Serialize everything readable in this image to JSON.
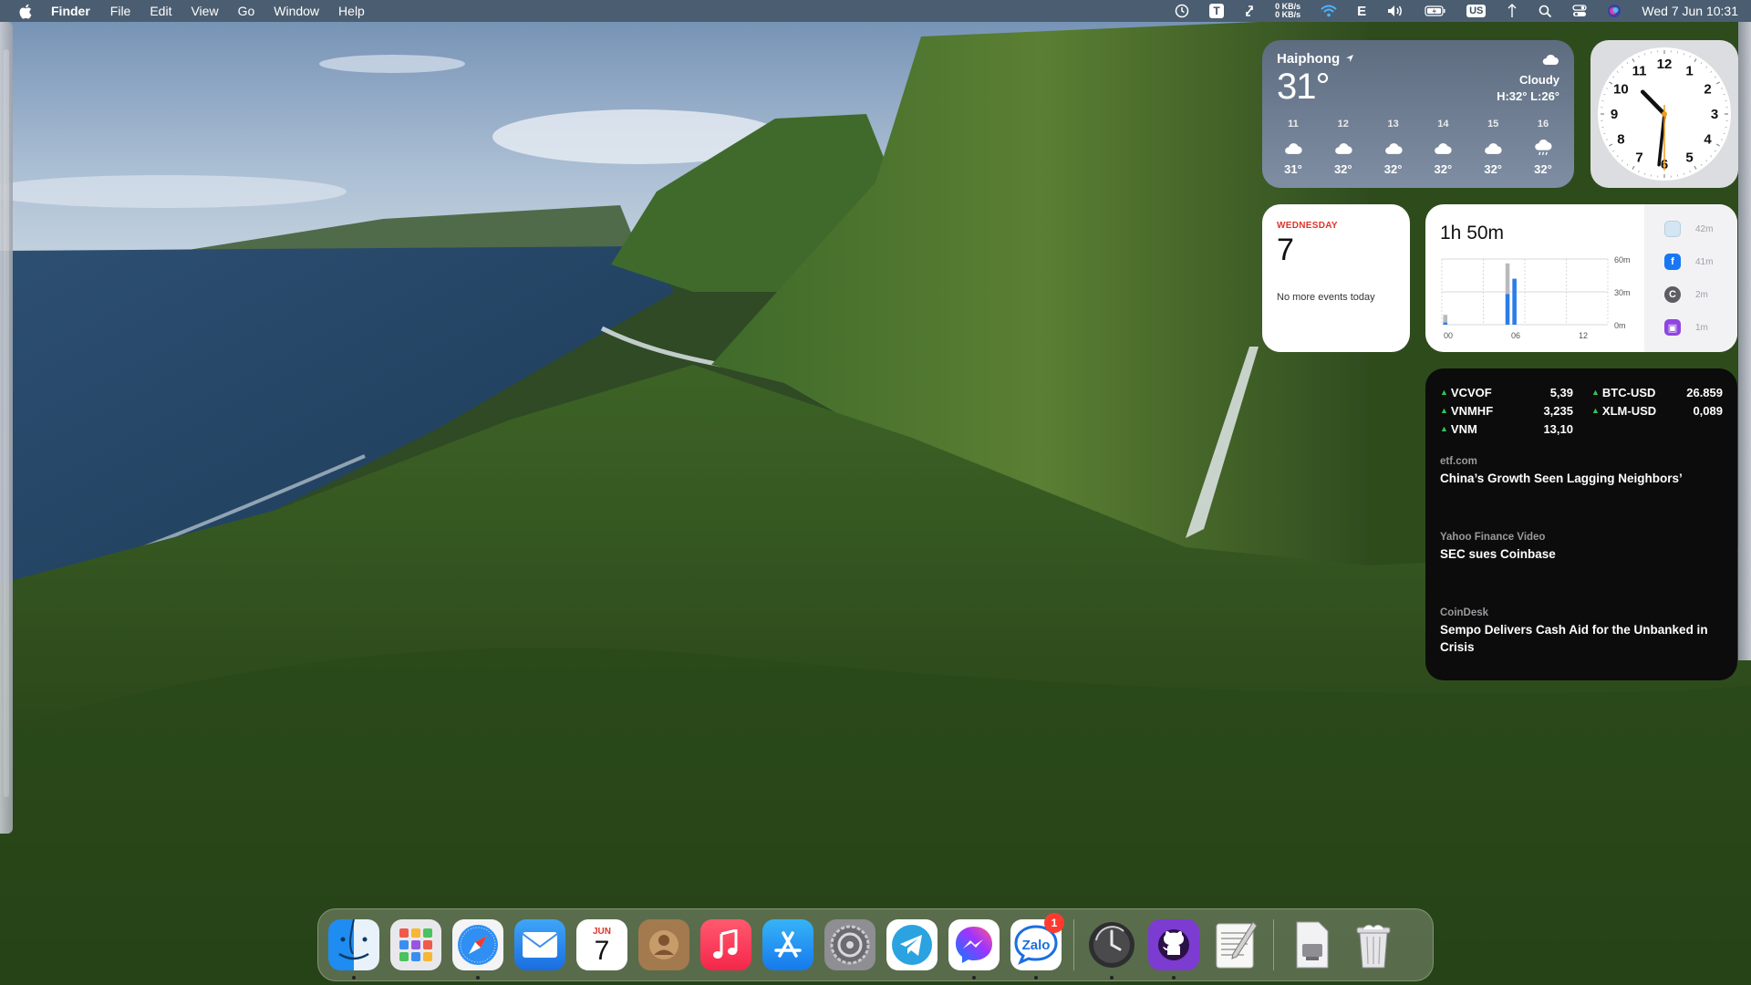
{
  "menubar": {
    "app_name": "Finder",
    "items": [
      "File",
      "Edit",
      "View",
      "Go",
      "Window",
      "Help"
    ],
    "net_up": "0 KB/s",
    "net_down": "0 KB/s",
    "input_letter": "E",
    "keyboard_layout": "US",
    "datetime": "Wed 7 Jun  10:31"
  },
  "weather": {
    "city": "Haiphong",
    "temp": "31°",
    "condition": "Cloudy",
    "hilo": "H:32° L:26°",
    "forecast": [
      {
        "hour": "11",
        "icon": "cloud-icon",
        "temp": "31°"
      },
      {
        "hour": "12",
        "icon": "cloud-icon",
        "temp": "32°"
      },
      {
        "hour": "13",
        "icon": "cloud-icon",
        "temp": "32°"
      },
      {
        "hour": "14",
        "icon": "cloud-icon",
        "temp": "32°"
      },
      {
        "hour": "15",
        "icon": "cloud-icon",
        "temp": "32°"
      },
      {
        "hour": "16",
        "icon": "cloud-rain-icon",
        "temp": "32°"
      }
    ]
  },
  "clock": {
    "numbers": [
      "12",
      "1",
      "2",
      "3",
      "4",
      "5",
      "6",
      "7",
      "8",
      "9",
      "10",
      "11"
    ],
    "hour": 10,
    "minute": 31
  },
  "calendar": {
    "weekday": "WEDNESDAY",
    "date": "7",
    "status": "No more events today"
  },
  "screentime": {
    "total": "1h 50m",
    "y_labels": [
      "60m",
      "30m",
      "0m"
    ],
    "x_labels": [
      "00",
      "06",
      "12"
    ],
    "apps": [
      {
        "icon": "app-icon-light",
        "minutes": "42m",
        "color": "#cfe4f2"
      },
      {
        "icon": "facebook-icon",
        "minutes": "41m",
        "color": "#1877f2"
      },
      {
        "icon": "c-app-icon",
        "minutes": "2m",
        "color": "#5d5d62"
      },
      {
        "icon": "purple-app-icon",
        "minutes": "1m",
        "color": "#8f45e0"
      }
    ],
    "chart_data": {
      "type": "bar",
      "x_labels": [
        "00",
        "06",
        "12"
      ],
      "ylim": [
        0,
        60
      ],
      "bars": [
        {
          "hour": 0,
          "total": 9,
          "blue": 2
        },
        {
          "hour": 9,
          "total": 56,
          "blue": 28
        },
        {
          "hour": 10,
          "total": 42,
          "blue": 42
        }
      ]
    }
  },
  "stocks": {
    "left": [
      {
        "symbol": "VCVOF",
        "price": "5,39"
      },
      {
        "symbol": "VNMHF",
        "price": "3,235"
      },
      {
        "symbol": "VNM",
        "price": "13,10"
      }
    ],
    "right": [
      {
        "symbol": "BTC-USD",
        "price": "26.859"
      },
      {
        "symbol": "XLM-USD",
        "price": "0,089"
      }
    ],
    "news": [
      {
        "source": "etf.com",
        "headline": "China’s Growth Seen Lagging Neighbors’"
      },
      {
        "source": "Yahoo Finance Video",
        "headline": "SEC sues Coinbase"
      },
      {
        "source": "CoinDesk",
        "headline": "Sempo Delivers Cash Aid for the Unbanked in Crisis"
      }
    ]
  },
  "dock": {
    "calendar_month": "JUN",
    "calendar_day": "7",
    "zalo_label": "Zalo",
    "zalo_badge": "1"
  }
}
